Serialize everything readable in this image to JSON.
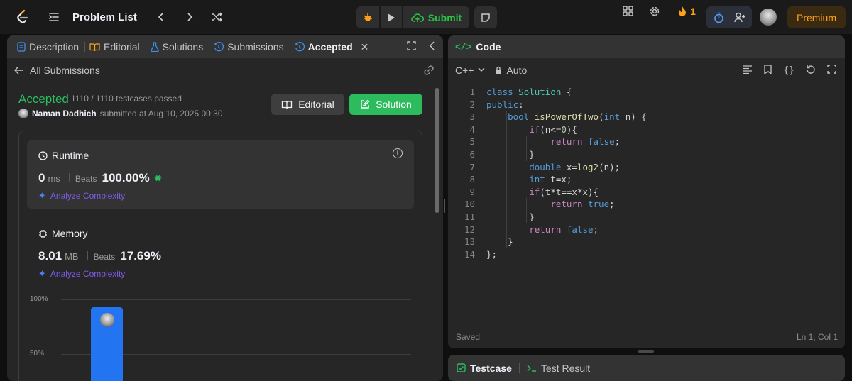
{
  "topbar": {
    "problem_list": "Problem List",
    "submit": "Submit",
    "streak": "1",
    "premium": "Premium"
  },
  "left_tabs": [
    {
      "label": "Description",
      "icon": "description-icon"
    },
    {
      "label": "Editorial",
      "icon": "book-icon"
    },
    {
      "label": "Solutions",
      "icon": "flask-icon"
    },
    {
      "label": "Submissions",
      "icon": "history-icon"
    },
    {
      "label": "Accepted",
      "icon": "history-icon",
      "active": true
    }
  ],
  "submission": {
    "back_label": "All Submissions",
    "status": "Accepted",
    "testcases": "1110 / 1110 testcases passed",
    "user": "Naman Dadhich",
    "submitted_text": "submitted at Aug 10, 2025 00:30",
    "editorial_btn": "Editorial",
    "solution_btn": "Solution"
  },
  "runtime": {
    "title": "Runtime",
    "value": "0",
    "unit": "ms",
    "beats_label": "Beats",
    "beats_value": "100.00%",
    "analyze": "Analyze Complexity"
  },
  "memory": {
    "title": "Memory",
    "value": "8.01",
    "unit": "MB",
    "beats_label": "Beats",
    "beats_value": "17.69%",
    "analyze": "Analyze Complexity"
  },
  "chart_data": {
    "type": "bar",
    "y_ticks": [
      "100%",
      "50%"
    ],
    "ylim": [
      0,
      100
    ],
    "values": [
      93
    ]
  },
  "editor": {
    "tab_label": "Code",
    "language": "C++",
    "mode": "Auto",
    "status": "Saved",
    "cursor": "Ln 1, Col 1",
    "code_lines": [
      "class Solution {",
      "public:",
      "    bool isPowerOfTwo(int n) {",
      "        if(n<=0){",
      "            return false;",
      "        }",
      "        double x=log2(n);",
      "        int t=x;",
      "        if(t*t==x*x){",
      "            return true;",
      "        }",
      "        return false;",
      "    }",
      "};"
    ]
  },
  "bottom": {
    "testcase": "Testcase",
    "test_result": "Test Result"
  },
  "colors": {
    "accent_green": "#2cbb5d",
    "premium": "#ffa116",
    "bar_blue": "#2374f0",
    "analyze_purple": "#7c5ce6"
  }
}
